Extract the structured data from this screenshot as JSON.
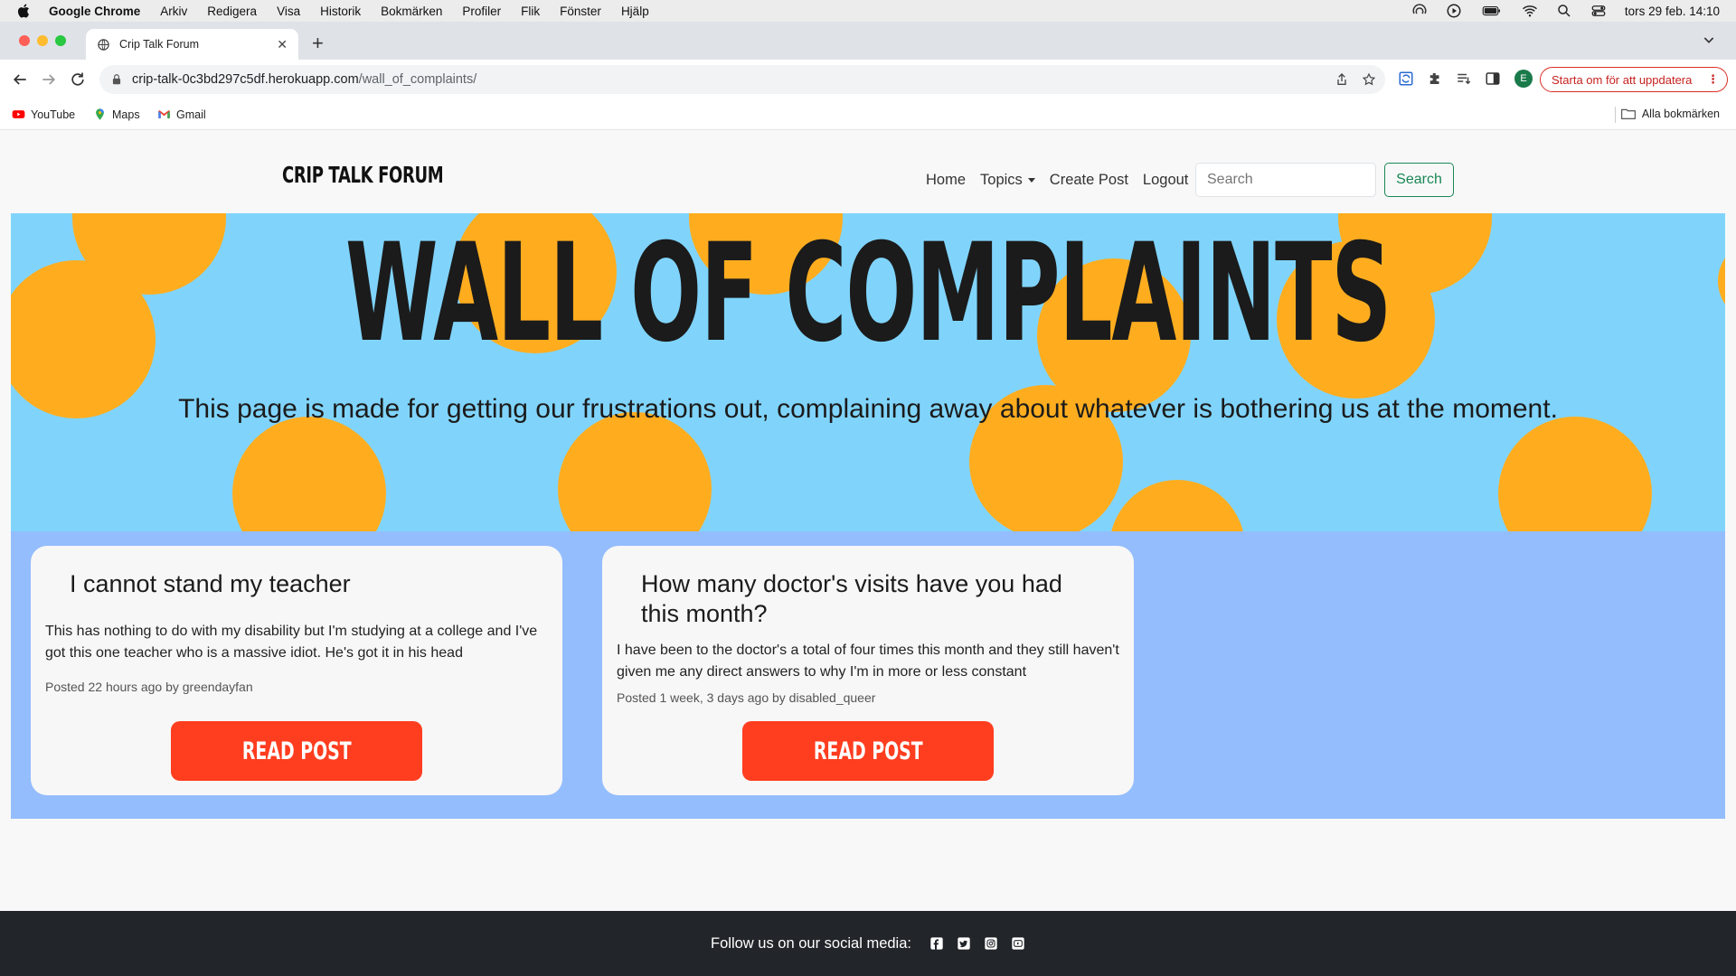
{
  "menubar": {
    "app_name": "Google Chrome",
    "items": [
      "Arkiv",
      "Redigera",
      "Visa",
      "Historik",
      "Bokmärken",
      "Profiler",
      "Flik",
      "Fönster",
      "Hjälp"
    ],
    "clock": "tors 29 feb. 14:10"
  },
  "browser": {
    "tab_title": "Crip Talk Forum",
    "url_host": "crip-talk-0c3bd297c5df.herokuapp.com",
    "url_path": "/wall_of_complaints/",
    "profile_initial": "E",
    "update_label": "Starta om för att uppdatera",
    "update_dots": "⋮",
    "new_tab_glyph": "+",
    "close_glyph": "✕"
  },
  "bookmarks": {
    "items": [
      "YouTube",
      "Maps",
      "Gmail"
    ],
    "all_label": "Alla bokmärken"
  },
  "site": {
    "brand": "CRIP TALK FORUM",
    "nav": {
      "home": "Home",
      "topics": "Topics",
      "create_post": "Create Post",
      "logout": "Logout"
    },
    "search_placeholder": "Search",
    "search_button": "Search"
  },
  "hero": {
    "title": "WALL OF COMPLAINTS",
    "subtitle": "This page is made for getting our frustrations out, complaining away about whatever is bothering us at the moment."
  },
  "posts": [
    {
      "title": "I cannot stand my teacher",
      "excerpt": "This has nothing to do with my disability but I'm studying at a college and I've got this one teacher who is a massive idiot. He's got it in his head",
      "meta": "Posted 22 hours ago by greendayfan",
      "button": "READ POST"
    },
    {
      "title": "How many doctor's visits have you had this month?",
      "excerpt": "I have been to the doctor's a total of four times this month and they still haven't given me any direct answers to why I'm in more or less constant",
      "meta": "Posted 1 week, 3 days ago by disabled_queer",
      "button": "READ POST"
    }
  ],
  "footer": {
    "text": "Follow us on our social media:",
    "social_icons": [
      "facebook-icon",
      "twitter-icon",
      "instagram-icon",
      "youtube-icon"
    ]
  },
  "colors": {
    "hero_bg": "#80d4fc",
    "hero_dots": "#ffad1f",
    "posts_bg": "#94bdfd",
    "read_button": "#ff3d1f",
    "search_green": "#198754",
    "footer_bg": "#222529"
  }
}
